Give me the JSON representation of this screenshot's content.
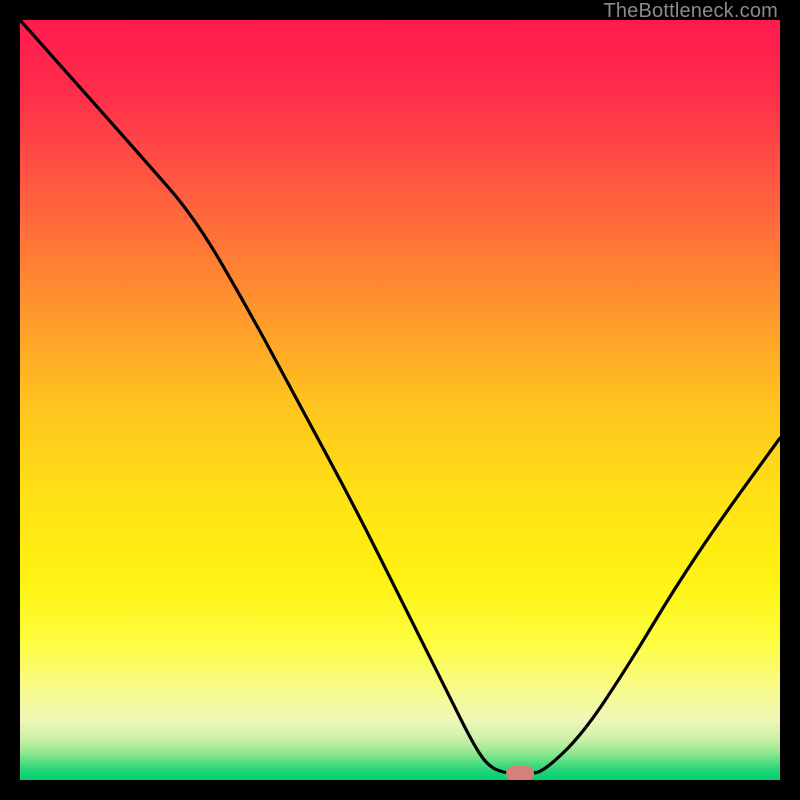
{
  "watermark": "TheBottleneck.com",
  "colors": {
    "black": "#000000",
    "curve_stroke": "#000000",
    "marker": "#d6807e",
    "watermark": "#888a8c"
  },
  "gradient_stops": [
    {
      "offset": 0.0,
      "color": "#ff1a4e"
    },
    {
      "offset": 0.1,
      "color": "#ff2f4a"
    },
    {
      "offset": 0.22,
      "color": "#ff5a40"
    },
    {
      "offset": 0.35,
      "color": "#ff8a30"
    },
    {
      "offset": 0.5,
      "color": "#ffc21f"
    },
    {
      "offset": 0.62,
      "color": "#ffe015"
    },
    {
      "offset": 0.74,
      "color": "#fff312"
    },
    {
      "offset": 0.82,
      "color": "#fdfd40"
    },
    {
      "offset": 0.88,
      "color": "#f7fb8a"
    },
    {
      "offset": 0.922,
      "color": "#eef8b8"
    },
    {
      "offset": 0.948,
      "color": "#c7f0a6"
    },
    {
      "offset": 0.965,
      "color": "#8ee68f"
    },
    {
      "offset": 0.978,
      "color": "#4edc80"
    },
    {
      "offset": 0.99,
      "color": "#19d477"
    },
    {
      "offset": 1.0,
      "color": "#05d072"
    }
  ],
  "chart_data": {
    "type": "line",
    "title": "",
    "xlabel": "",
    "ylabel": "",
    "xlim": [
      0,
      100
    ],
    "ylim": [
      0,
      100
    ],
    "grid": false,
    "series": [
      {
        "name": "bottleneck-curve",
        "x": [
          0,
          8,
          16,
          23,
          30,
          37,
          44,
          50,
          56,
          60,
          62,
          64.5,
          67,
          69,
          74,
          80,
          86,
          92,
          100
        ],
        "y": [
          100,
          91,
          82,
          74,
          62,
          49,
          36,
          24,
          12,
          4,
          1.5,
          0.8,
          0.8,
          1.2,
          6,
          15,
          25,
          34,
          45
        ]
      }
    ],
    "marker": {
      "x": 65.8,
      "y": 0.8,
      "w_pct": 3.6,
      "h_pct": 2.0
    }
  }
}
